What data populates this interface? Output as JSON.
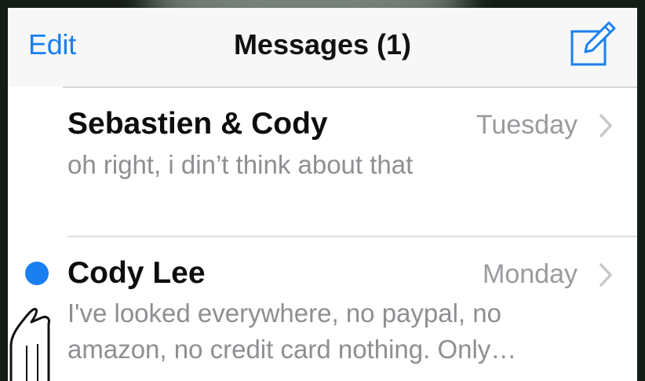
{
  "navbar": {
    "edit_label": "Edit",
    "title": "Messages (1)",
    "compose_icon": "compose-icon"
  },
  "conversations": [
    {
      "name": "Sebastien & Cody",
      "date": "Tuesday",
      "preview": "oh right, i din’t think about that",
      "unread": false
    },
    {
      "name": "Cody Lee",
      "date": "Monday",
      "preview": "I've looked everywhere, no paypal, no amazon, no credit card nothing. Only…",
      "unread": true
    }
  ],
  "colors": {
    "accent": "#1a7ff0",
    "secondary_text": "#8e8e93"
  }
}
